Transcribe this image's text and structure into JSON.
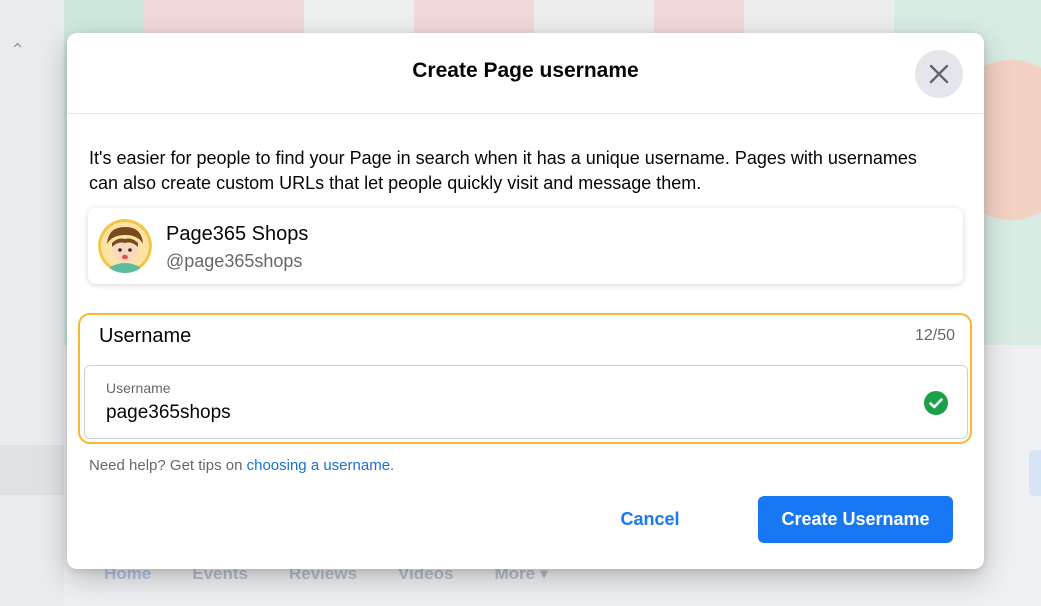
{
  "background": {
    "tabs": [
      "Home",
      "Events",
      "Reviews",
      "Videos",
      "More ▾"
    ]
  },
  "dialog": {
    "title": "Create Page username",
    "close_icon": "close-icon",
    "intro": "It's easier for people to find your Page in search when it has a unique username. Pages with usernames can also create custom URLs that let people quickly visit and message them.",
    "page": {
      "name": "Page365 Shops",
      "handle": "@page365shops"
    },
    "username": {
      "section_label": "Username",
      "char_count": "12/50",
      "field_label": "Username",
      "value": "page365shops",
      "status_icon": "check-circle-icon",
      "status_color": "#1aa148"
    },
    "help": {
      "prefix": "Need help? Get tips on ",
      "link": "choosing a username."
    },
    "buttons": {
      "cancel": "Cancel",
      "create": "Create Username"
    },
    "colors": {
      "accent": "#1877f2",
      "highlight_border": "#f7b731"
    }
  }
}
